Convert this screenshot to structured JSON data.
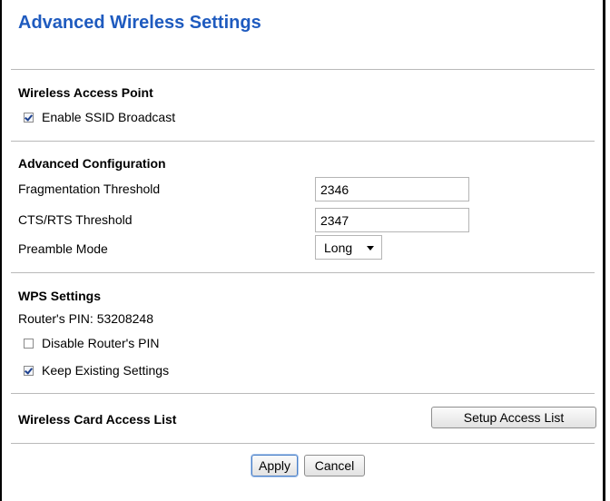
{
  "page": {
    "title": "Advanced Wireless Settings"
  },
  "wireless_access_point": {
    "heading": "Wireless Access Point",
    "enable_ssid_broadcast": {
      "label": "Enable SSID Broadcast",
      "checked": true
    }
  },
  "advanced_configuration": {
    "heading": "Advanced Configuration",
    "fragmentation_threshold": {
      "label": "Fragmentation Threshold",
      "value": "2346"
    },
    "cts_rts_threshold": {
      "label": "CTS/RTS Threshold",
      "value": "2347"
    },
    "preamble_mode": {
      "label": "Preamble Mode",
      "value": "Long"
    }
  },
  "wps_settings": {
    "heading": "WPS Settings",
    "router_pin": "Router's PIN: 53208248",
    "disable_router_pin": {
      "label": "Disable Router's PIN",
      "checked": false
    },
    "keep_existing_settings": {
      "label": "Keep Existing Settings",
      "checked": true
    }
  },
  "access_list": {
    "heading": "Wireless Card Access List",
    "setup_button": "Setup Access List"
  },
  "actions": {
    "apply": "Apply",
    "cancel": "Cancel"
  },
  "colors": {
    "title": "#1f5bbf",
    "divider": "#b9b9b9",
    "check_mark": "#1b3f8e"
  }
}
